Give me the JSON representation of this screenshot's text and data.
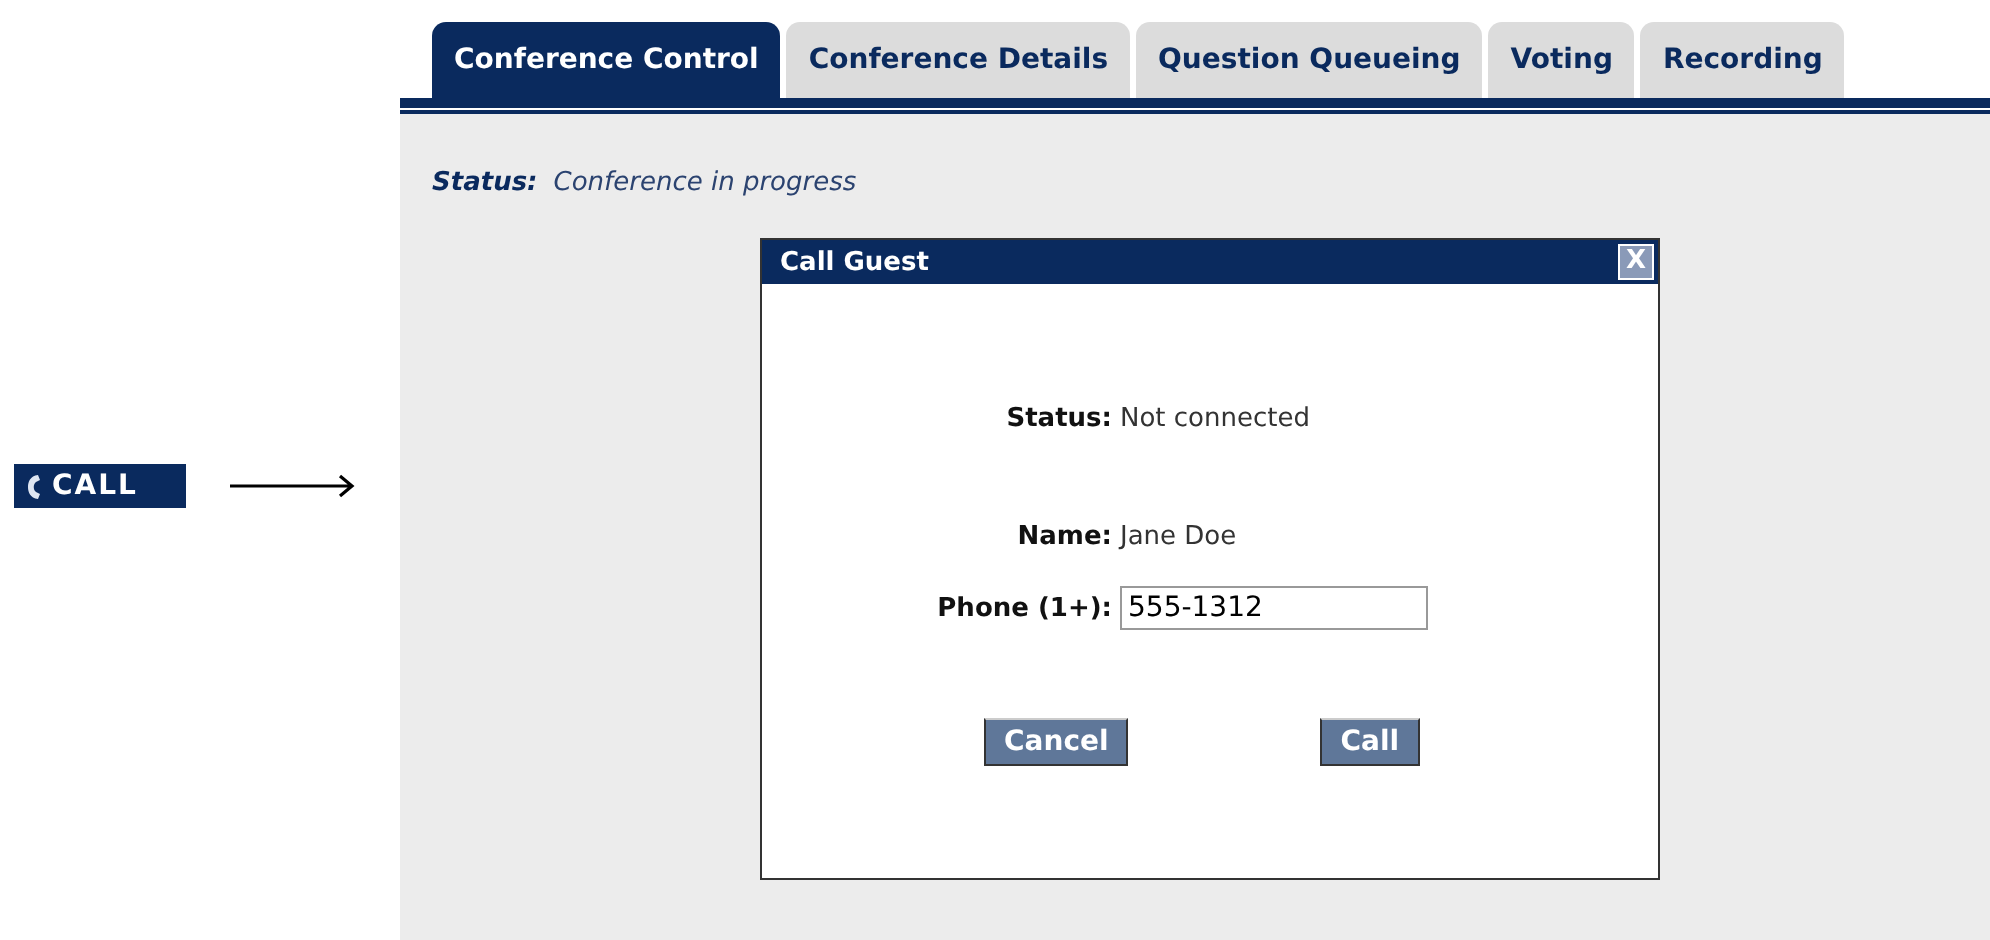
{
  "call_button": {
    "label": "CALL"
  },
  "tabs": [
    {
      "label": "Conference Control",
      "selected": true
    },
    {
      "label": "Conference Details",
      "selected": false
    },
    {
      "label": "Question Queueing",
      "selected": false
    },
    {
      "label": "Voting",
      "selected": false
    },
    {
      "label": "Recording",
      "selected": false
    }
  ],
  "status": {
    "label": "Status:",
    "value": "Conference in progress"
  },
  "dialog": {
    "title": "Call Guest",
    "close": "X",
    "fields": [
      {
        "kind": "text",
        "label": "Status:",
        "value": "Not connected"
      },
      {
        "kind": "text",
        "label": "Name:",
        "value": "Jane Doe"
      },
      {
        "kind": "input",
        "label": "Phone (1+):",
        "value": "555-1312"
      }
    ],
    "buttons": [
      "Cancel",
      "Call"
    ]
  }
}
